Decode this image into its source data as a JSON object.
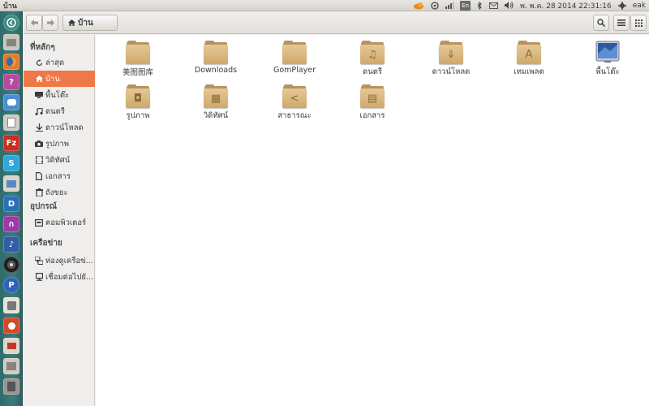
{
  "top_panel": {
    "window_title": "บ้าน",
    "language": "En",
    "datetime": "พ. พ.ค. 28 2014 22:31:16",
    "user": "eak"
  },
  "breadcrumb": {
    "label": "บ้าน"
  },
  "sidebar": {
    "places_title": "ที่หลักๆ",
    "places": [
      {
        "label": "ล่าสุด",
        "icon": "recent-icon"
      },
      {
        "label": "บ้าน",
        "icon": "home-icon",
        "active": true
      },
      {
        "label": "พื้นโต๊ะ",
        "icon": "desktop-icon"
      },
      {
        "label": "ดนตรี",
        "icon": "music-icon"
      },
      {
        "label": "ดาวน์โหลด",
        "icon": "download-icon"
      },
      {
        "label": "รูปภาพ",
        "icon": "camera-icon"
      },
      {
        "label": "วิดิทัศน์",
        "icon": "video-icon"
      },
      {
        "label": "เอกสาร",
        "icon": "document-icon"
      },
      {
        "label": "ถังขยะ",
        "icon": "trash-icon"
      }
    ],
    "devices_title": "อุปกรณ์",
    "devices": [
      {
        "label": "คอมพิวเตอร์",
        "icon": "computer-icon"
      }
    ],
    "network_title": "เครือข่าย",
    "network": [
      {
        "label": "ท่องดูเครือข่...",
        "icon": "network-icon"
      },
      {
        "label": "เชื่อมต่อไปยั...",
        "icon": "server-icon"
      }
    ]
  },
  "files": [
    {
      "label": "美图图库",
      "icon": "folder-icon"
    },
    {
      "label": "Downloads",
      "icon": "folder-icon"
    },
    {
      "label": "GomPlayer",
      "icon": "folder-icon"
    },
    {
      "label": "ดนตรี",
      "icon": "music-folder-icon"
    },
    {
      "label": "ดาวน์โหลด",
      "icon": "download-folder-icon"
    },
    {
      "label": "เทมเพลต",
      "icon": "templates-folder-icon"
    },
    {
      "label": "พื้นโต๊ะ",
      "icon": "desktop-folder-icon"
    },
    {
      "label": "รูปภาพ",
      "icon": "pictures-folder-icon"
    },
    {
      "label": "วิดิทัศน์",
      "icon": "videos-folder-icon"
    },
    {
      "label": "สาธารณะ",
      "icon": "public-folder-icon"
    },
    {
      "label": "เอกสาร",
      "icon": "documents-folder-icon"
    }
  ],
  "colors": {
    "accent": "#f07746",
    "folder": "#d9b77f",
    "launcher": "#3a7c7a"
  }
}
